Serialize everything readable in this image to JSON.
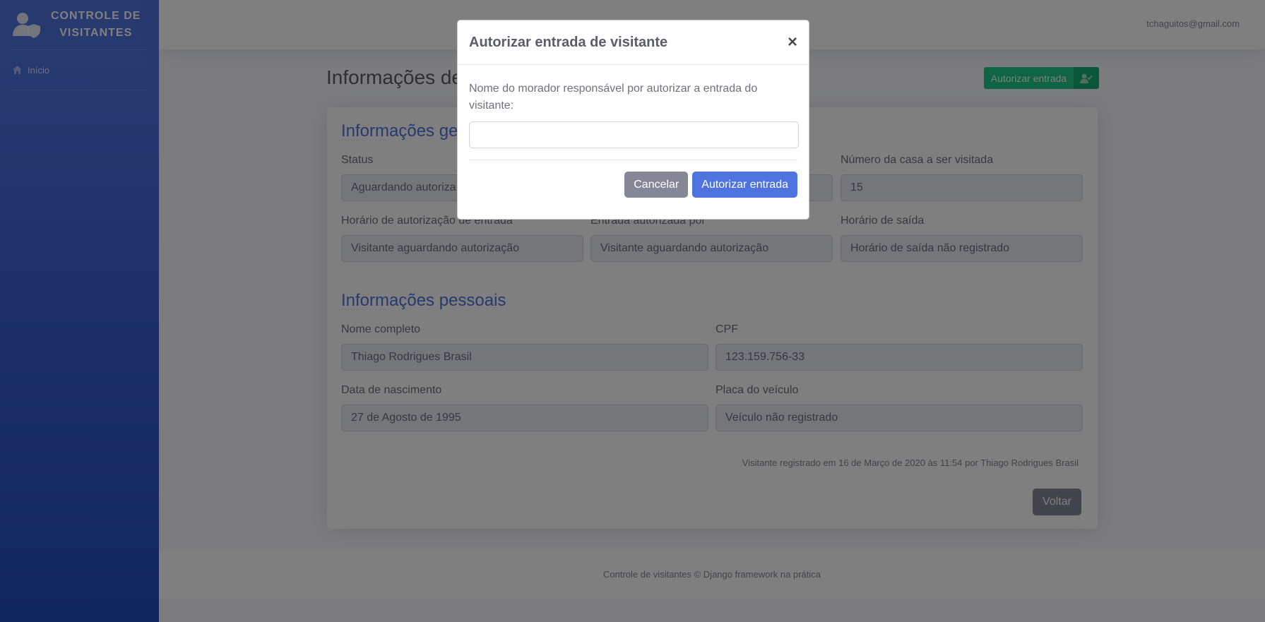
{
  "sidebar": {
    "brand_line1": "CONTROLE DE",
    "brand_line2": "VISITANTES",
    "items": [
      {
        "label": "Início",
        "icon": "home-icon"
      }
    ]
  },
  "topbar": {
    "user_email": "tchaguitos@gmail.com"
  },
  "page": {
    "title": "Informações de",
    "authorize_button": "Autorizar entrada",
    "general_section": "Informações ge",
    "fields_general": {
      "status_label": "Status",
      "status_value": "Aguardando autoriza",
      "house_label": "Número da casa a ser visitada",
      "house_value": "15",
      "auth_time_label": "Horário de autorização de entrada",
      "auth_time_value": "Visitante aguardando autorização",
      "auth_by_label": "Entrada autorizada por",
      "auth_by_value": "Visitante aguardando autorização",
      "exit_label": "Horário de saída",
      "exit_value": "Horário de saída não registrado"
    },
    "personal_section": "Informações pessoais",
    "fields_personal": {
      "name_label": "Nome completo",
      "name_value": "Thiago Rodrigues Brasil",
      "cpf_label": "CPF",
      "cpf_value": "123.159.756-33",
      "birth_label": "Data de nascimento",
      "birth_value": "27 de Agosto de 1995",
      "plate_label": "Placa do veículo",
      "plate_value": "Veículo não registrado"
    },
    "registered_text": "Visitante registrado em 16 de Março de 2020 às 11:54 por Thiago Rodrigues Brasil",
    "back_button": "Voltar"
  },
  "footer": {
    "text": "Controle de visitantes © Django framework na prática"
  },
  "modal": {
    "title": "Autorizar entrada de visitante",
    "close_symbol": "×",
    "label": "Nome do morador responsável por autorizar a entrada do visitante:",
    "input_value": "",
    "cancel_button": "Cancelar",
    "confirm_button": "Autorizar entrada"
  },
  "colors": {
    "primary": "#4e73df",
    "success": "#1cc88a",
    "secondary": "#858796"
  }
}
